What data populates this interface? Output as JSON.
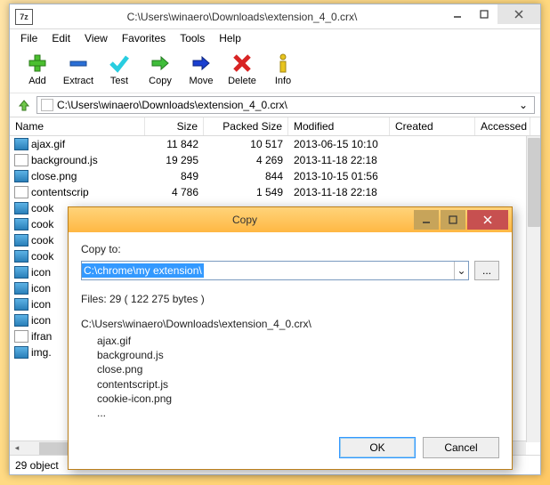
{
  "main": {
    "title": "C:\\Users\\winaero\\Downloads\\extension_4_0.crx\\",
    "app_icon_text": "7z",
    "path": "C:\\Users\\winaero\\Downloads\\extension_4_0.crx\\",
    "status": "29 object"
  },
  "menu": {
    "file": "File",
    "edit": "Edit",
    "view": "View",
    "favorites": "Favorites",
    "tools": "Tools",
    "help": "Help"
  },
  "toolbar": {
    "add": "Add",
    "extract": "Extract",
    "test": "Test",
    "copy": "Copy",
    "move": "Move",
    "delete": "Delete",
    "info": "Info"
  },
  "columns": {
    "name": "Name",
    "size": "Size",
    "packed": "Packed Size",
    "modified": "Modified",
    "created": "Created",
    "accessed": "Accessed"
  },
  "files": [
    {
      "name": "ajax.gif",
      "type": "img",
      "size": "11 842",
      "packed": "10 517",
      "modified": "2013-06-15 10:10"
    },
    {
      "name": "background.js",
      "type": "js",
      "size": "19 295",
      "packed": "4 269",
      "modified": "2013-11-18 22:18"
    },
    {
      "name": "close.png",
      "type": "img",
      "size": "849",
      "packed": "844",
      "modified": "2013-10-15 01:56"
    },
    {
      "name": "contentscrip",
      "type": "js",
      "size": "4 786",
      "packed": "1 549",
      "modified": "2013-11-18 22:18"
    },
    {
      "name": "cook",
      "type": "img",
      "size": "",
      "packed": "",
      "modified": ""
    },
    {
      "name": "cook",
      "type": "img",
      "size": "",
      "packed": "",
      "modified": ""
    },
    {
      "name": "cook",
      "type": "img",
      "size": "",
      "packed": "",
      "modified": ""
    },
    {
      "name": "cook",
      "type": "img",
      "size": "",
      "packed": "",
      "modified": ""
    },
    {
      "name": "icon",
      "type": "img",
      "size": "",
      "packed": "",
      "modified": ""
    },
    {
      "name": "icon",
      "type": "img",
      "size": "",
      "packed": "",
      "modified": ""
    },
    {
      "name": "icon",
      "type": "img",
      "size": "",
      "packed": "",
      "modified": ""
    },
    {
      "name": "icon",
      "type": "img",
      "size": "",
      "packed": "",
      "modified": ""
    },
    {
      "name": "ifran",
      "type": "js",
      "size": "",
      "packed": "",
      "modified": ""
    },
    {
      "name": "img.",
      "type": "img",
      "size": "",
      "packed": "",
      "modified": ""
    }
  ],
  "dialog": {
    "title": "Copy",
    "copy_to_label": "Copy to:",
    "copy_to_value": "C:\\chrome\\my extension\\",
    "browse": "...",
    "files_info": "Files: 29    ( 122 275 bytes )",
    "source_path": "C:\\Users\\winaero\\Downloads\\extension_4_0.crx\\",
    "listing": [
      "ajax.gif",
      "background.js",
      "close.png",
      "contentscript.js",
      "cookie-icon.png",
      "..."
    ],
    "ok": "OK",
    "cancel": "Cancel"
  }
}
